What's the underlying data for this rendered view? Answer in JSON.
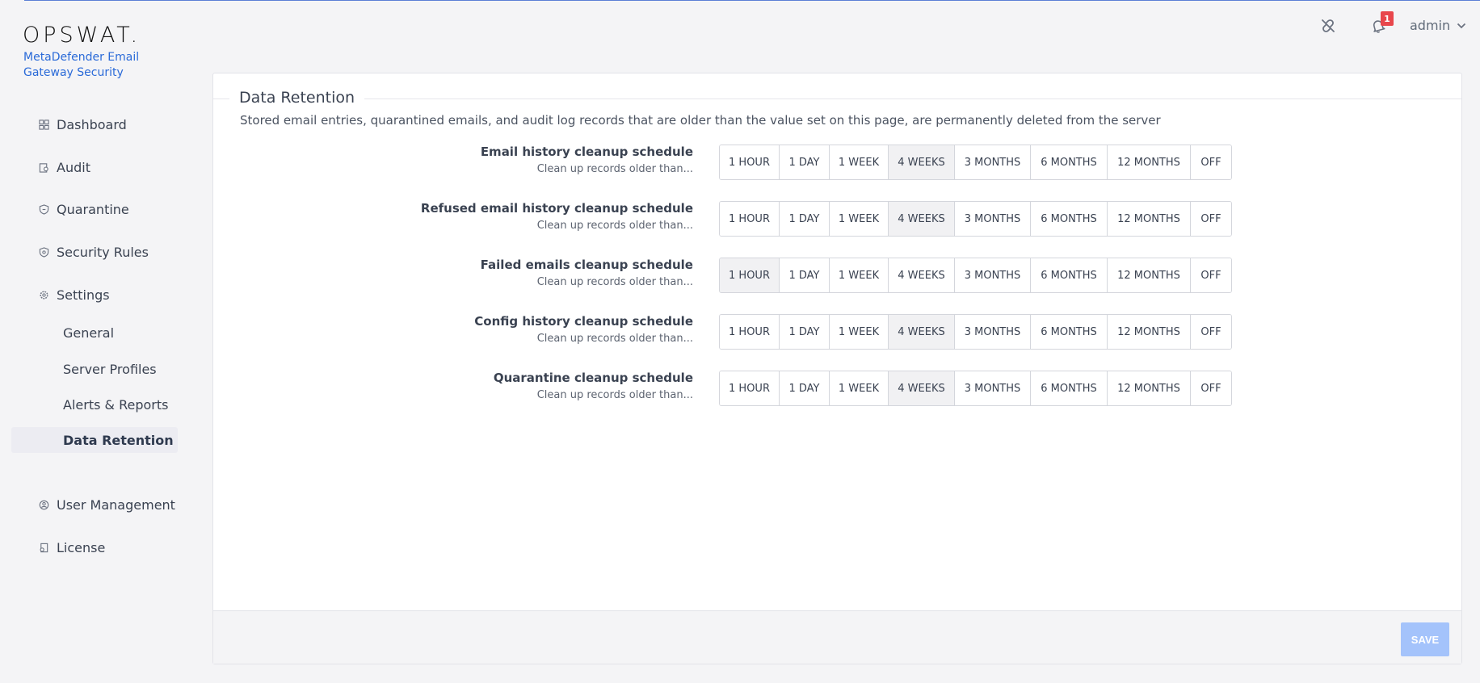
{
  "brand": {
    "logo": "OPSWAT.",
    "product": "MetaDefender Email Gateway Security"
  },
  "header": {
    "notification_count": "1",
    "user": "admin"
  },
  "nav": {
    "dashboard": "Dashboard",
    "audit": "Audit",
    "quarantine": "Quarantine",
    "security_rules": "Security Rules",
    "settings": "Settings",
    "settings_sub": {
      "general": "General",
      "server_profiles": "Server Profiles",
      "alerts_reports": "Alerts & Reports",
      "data_retention": "Data Retention"
    },
    "user_management": "User Management",
    "license": "License"
  },
  "page": {
    "title": "Data Retention",
    "description": "Stored email entries, quarantined emails, and audit log records that are older than the value set on this page, are permanently deleted from the server",
    "options": [
      "1 HOUR",
      "1 DAY",
      "1 WEEK",
      "4 WEEKS",
      "3 MONTHS",
      "6 MONTHS",
      "12 MONTHS",
      "OFF"
    ],
    "rows": [
      {
        "title": "Email history cleanup schedule",
        "subtitle": "Clean up records older than...",
        "selected": "4 WEEKS"
      },
      {
        "title": "Refused email history cleanup schedule",
        "subtitle": "Clean up records older than...",
        "selected": "4 WEEKS"
      },
      {
        "title": "Failed emails cleanup schedule",
        "subtitle": "Clean up records older than...",
        "selected": "1 HOUR"
      },
      {
        "title": "Config history cleanup schedule",
        "subtitle": "Clean up records older than...",
        "selected": "4 WEEKS"
      },
      {
        "title": "Quarantine cleanup schedule",
        "subtitle": "Clean up records older than...",
        "selected": "4 WEEKS"
      }
    ],
    "save_label": "SAVE"
  },
  "colors": {
    "accent": "#2a6ad8",
    "save_disabled": "#a4c3fb",
    "badge": "#e8474c"
  }
}
